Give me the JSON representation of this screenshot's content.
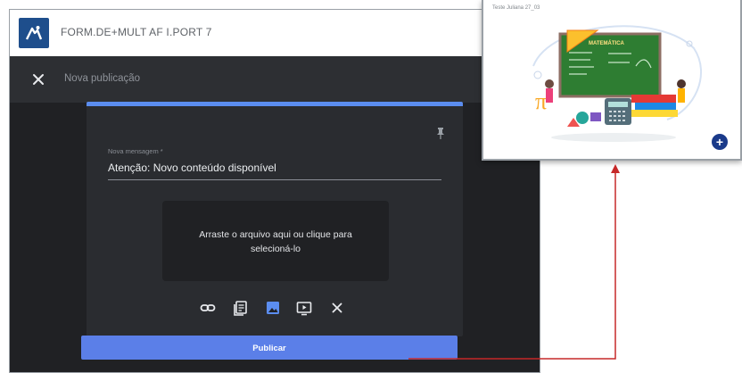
{
  "app": {
    "title": "FORM.DE+MULT AF I.PORT 7",
    "brand_color": "#1e4e8c"
  },
  "compose": {
    "header_title": "Nova publicação",
    "message_label": "Nova mensagem *",
    "message_value": "Atenção: Novo conteúdo disponível",
    "dropzone_text": "Arraste o arquivo aqui ou clique para selecioná-lo",
    "toolbar_icons": [
      "link-icon",
      "document-icon",
      "image-icon",
      "video-icon",
      "close-icon"
    ],
    "active_tool": "image-icon",
    "accent_color": "#5b8def"
  },
  "publish": {
    "label": "Publicar",
    "color": "#5b7fe8"
  },
  "preview": {
    "caption": "Teste Juliana 27_03",
    "board_title": "MATEMÁTICA",
    "fab_label": "+"
  },
  "arrow_color": "#c62828"
}
